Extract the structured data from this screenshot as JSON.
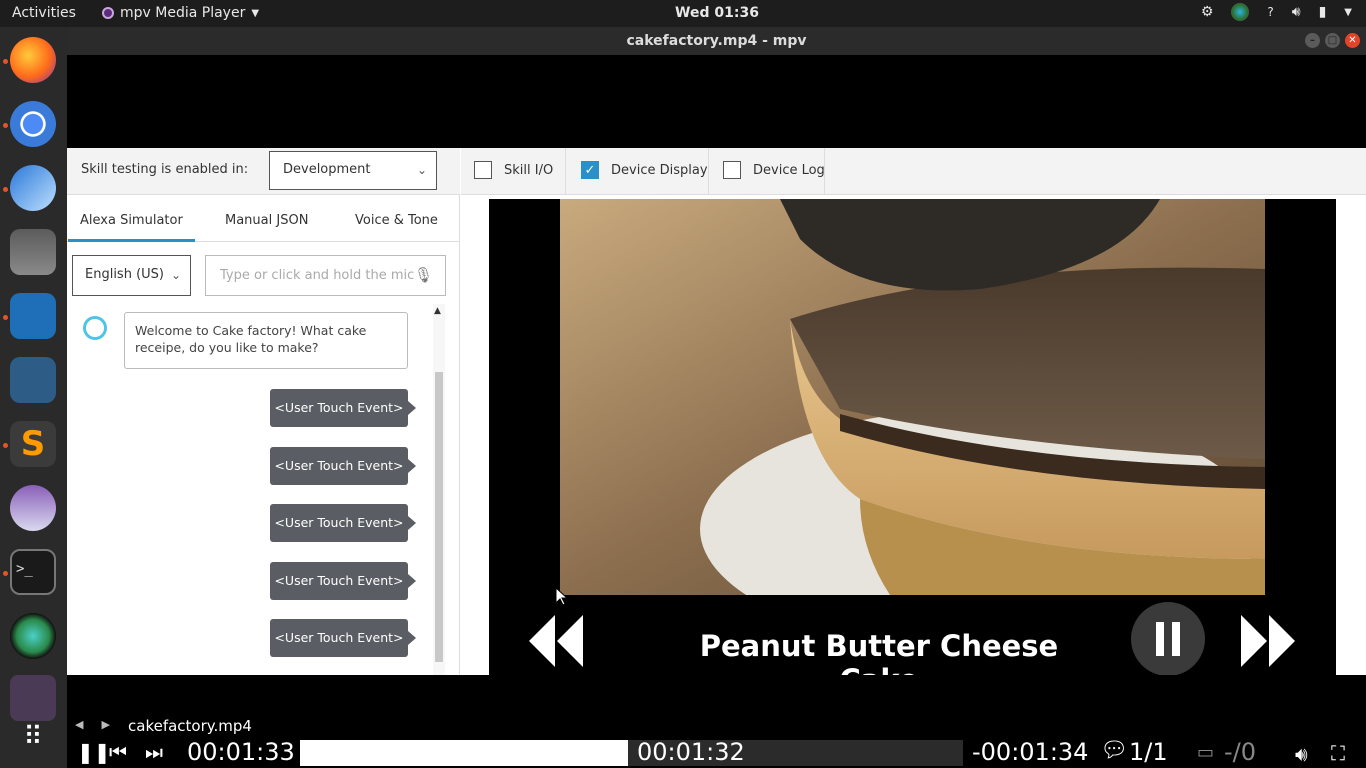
{
  "topbar": {
    "activities": "Activities",
    "app_name": "mpv Media Player",
    "clock": "Wed 01:36"
  },
  "window": {
    "title": "cakefactory.mp4 - mpv"
  },
  "simulator": {
    "skill_testing_label": "Skill testing is enabled in:",
    "skill_stage": "Development",
    "tabs": [
      "Alexa Simulator",
      "Manual JSON",
      "Voice & Tone"
    ],
    "active_tab": "Alexa Simulator",
    "locale": "English (US)",
    "input_placeholder": "Type or click and hold the mic",
    "checkboxes": [
      {
        "label": "Skill I/O",
        "checked": false
      },
      {
        "label": "Device Display",
        "checked": true
      },
      {
        "label": "Device Log",
        "checked": false
      }
    ],
    "bot_message": "Welcome to Cake factory! What cake receipe, do you like to make?",
    "user_messages": [
      "<User Touch Event>",
      "<User Touch Event>",
      "<User Touch Event>",
      "<User Touch Event>",
      "<User Touch Event>"
    ]
  },
  "display": {
    "caption": "Peanut Butter Cheese Cake"
  },
  "osc": {
    "filename": "cakefactory.mp4",
    "elapsed": "00:01:33",
    "seek_time": "00:01:32",
    "remaining": "-00:01:34",
    "progress_fraction": 0.495,
    "subtitle_track": "1/1",
    "audio_track": "-/0",
    "colors": {
      "seek_fill": "#ffffff",
      "seek_bg": "#2b2b2b"
    }
  },
  "colors": {
    "accent": "#2a90c7",
    "user_bubble": "#5a5d63",
    "close_button": "#e0452a"
  }
}
